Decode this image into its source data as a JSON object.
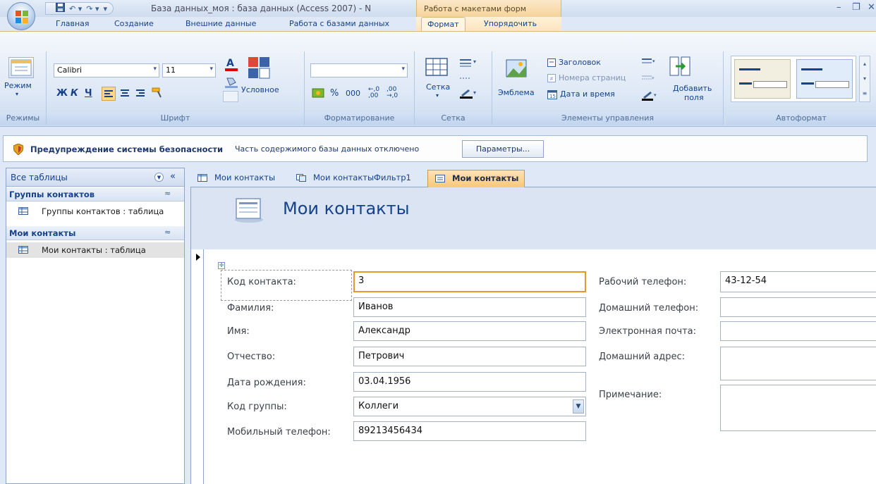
{
  "window": {
    "title": "База данных_моя : база данных (Access 2007) - N",
    "context_tab_group": "Работа с макетами форм"
  },
  "ribbon": {
    "tabs": [
      "Главная",
      "Создание",
      "Внешние данные",
      "Работа с базами данных",
      "Формат",
      "Упорядочить"
    ],
    "active_tab": "Формат",
    "groups": {
      "modes": {
        "label": "Режимы",
        "button": "Режим"
      },
      "font": {
        "label": "Шрифт",
        "font_name": "Calibri",
        "font_size": "11",
        "bold": "Ж",
        "italic": "К",
        "underline": "Ч",
        "conditional": "Условное"
      },
      "formatting": {
        "label": "Форматирование",
        "percent": "%",
        "thousands": "000",
        "inc_decimal": "←,0\n,00",
        "dec_decimal": ",00\n→,0"
      },
      "grid": {
        "label": "Сетка",
        "button": "Сетка"
      },
      "controls": {
        "label": "Элементы управления",
        "logo": "Эмблема",
        "title": "Заголовок",
        "page_numbers": "Номера страниц",
        "date_time": "Дата и время",
        "add_fields": "Добавить",
        "add_fields_2": "поля"
      },
      "autoformat": {
        "label": "Автоформат"
      }
    }
  },
  "security_bar": {
    "title": "Предупреждение системы безопасности",
    "message": "Часть содержимого базы данных отключено",
    "button": "Параметры..."
  },
  "nav_pane": {
    "header": "Все таблицы",
    "groups": [
      {
        "name": "Группы контактов",
        "items": [
          "Группы контактов : таблица"
        ]
      },
      {
        "name": "Мои контакты",
        "items": [
          "Мои контакты : таблица"
        ]
      }
    ]
  },
  "doc_tabs": [
    {
      "label": "Мои контакты",
      "type": "table"
    },
    {
      "label": "Мои контактыФильтр1",
      "type": "query"
    },
    {
      "label": "Мои контакты",
      "type": "form",
      "active": true
    }
  ],
  "form": {
    "title": "Мои контакты",
    "left_fields": [
      {
        "label": "Код контакта:",
        "value": "3"
      },
      {
        "label": "Фамилия:",
        "value": "Иванов"
      },
      {
        "label": "Имя:",
        "value": "Александр"
      },
      {
        "label": "Отчество:",
        "value": "Петрович"
      },
      {
        "label": "Дата рождения:",
        "value": "03.04.1956"
      },
      {
        "label": "Код группы:",
        "value": "Коллеги"
      },
      {
        "label": "Мобильный телефон:",
        "value": "89213456434"
      }
    ],
    "right_fields": [
      {
        "label": "Рабочий телефон:",
        "value": "43-12-54"
      },
      {
        "label": "Домашний телефон:",
        "value": ""
      },
      {
        "label": "Электронная почта:",
        "value": ""
      },
      {
        "label": "Домашний адрес:",
        "value": ""
      },
      {
        "label": "Примечание:",
        "value": ""
      }
    ]
  },
  "colors": {
    "accent": "#15428b",
    "ribbon_bg": "#dce7f5",
    "context_tab": "#f6d39a",
    "focus_border": "#e39a2c"
  }
}
